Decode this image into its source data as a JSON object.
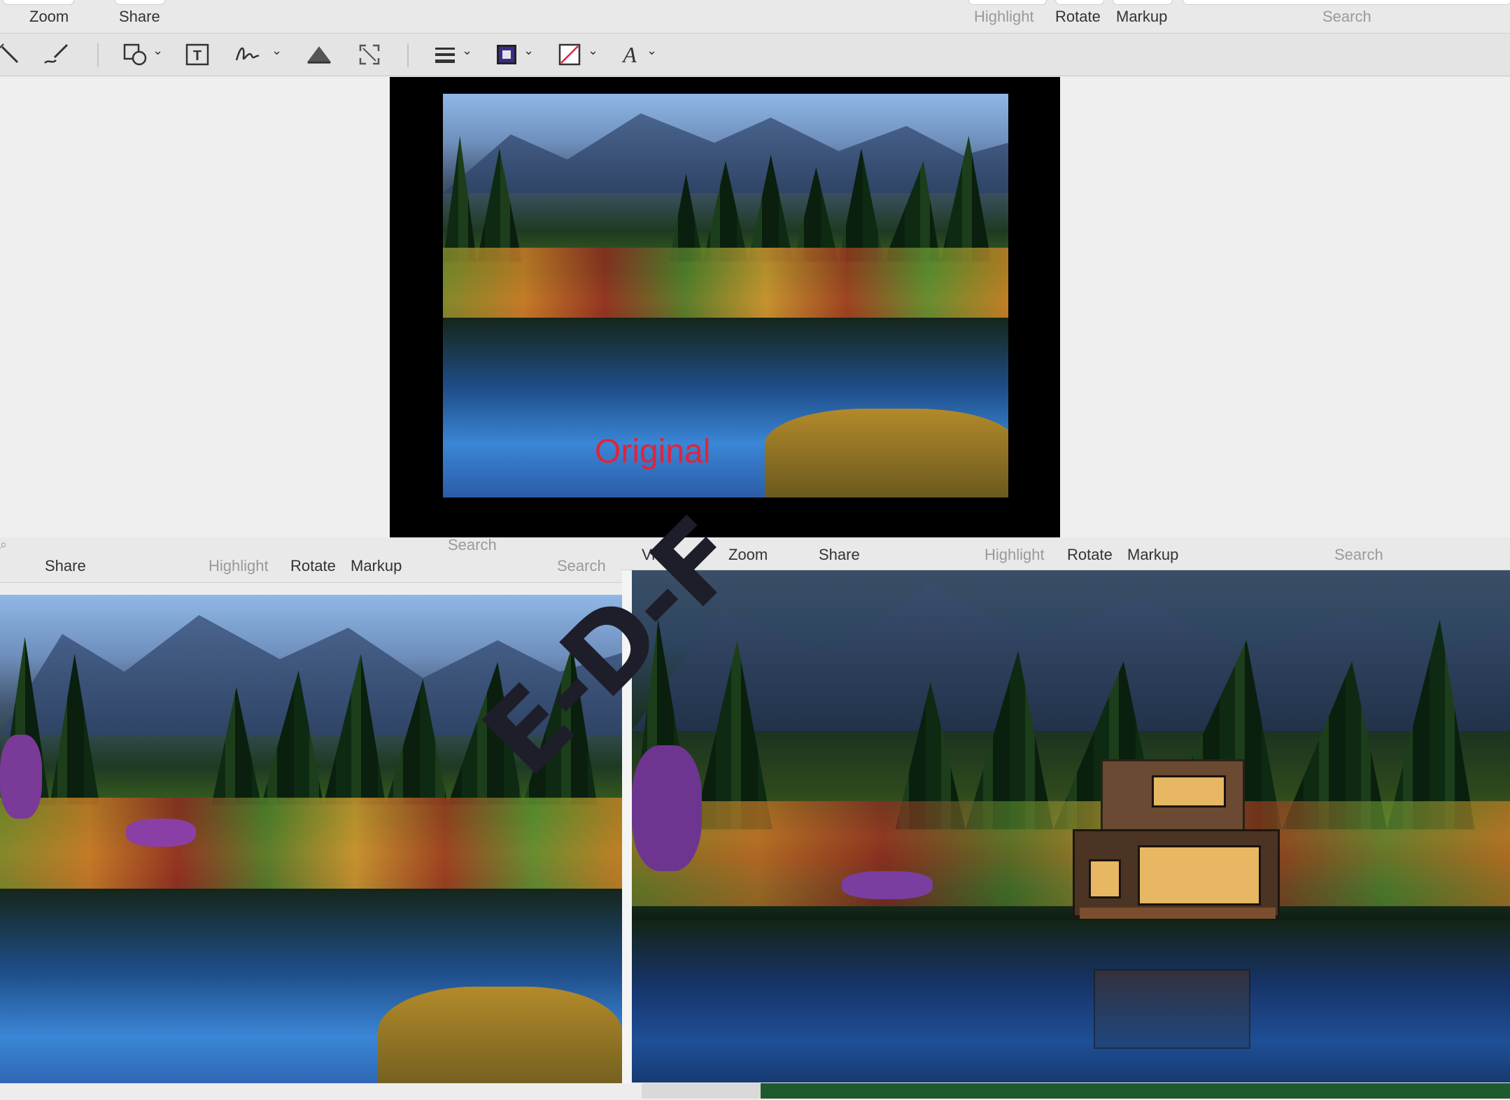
{
  "top_window": {
    "toolbar": {
      "zoom_label": "Zoom",
      "share_label": "Share",
      "highlight_label": "Highlight",
      "rotate_label": "Rotate",
      "markup_label": "Markup",
      "search_label": "Search"
    },
    "markup_tools": [
      "magic-wand-icon",
      "sketch-icon",
      "shapes-icon",
      "text-box-icon",
      "signature-icon",
      "adjust-color-icon",
      "resize-icon",
      "line-style-icon",
      "border-color-icon",
      "fill-color-icon",
      "text-style-icon"
    ],
    "document": {
      "overlay_text": "Original"
    }
  },
  "bottom_left_window": {
    "toolbar": {
      "share_label": "Share",
      "highlight_label": "Highlight",
      "rotate_label": "Rotate",
      "markup_label": "Markup",
      "search_label": "Search",
      "search_placeholder": "Search"
    }
  },
  "bottom_right_window": {
    "toolbar": {
      "view_label": "Vie",
      "zoom_label": "Zoom",
      "share_label": "Share",
      "highlight_label": "Highlight",
      "rotate_label": "Rotate",
      "markup_label": "Markup",
      "search_label": "Search"
    }
  },
  "watermark": {
    "text": "E-D-F"
  },
  "colors": {
    "label_red": "#e0243a",
    "border_color_swatch": "#3b2a8f",
    "watermark": "#1e1e2a",
    "toolbar_bg": "#e9e9e9"
  }
}
